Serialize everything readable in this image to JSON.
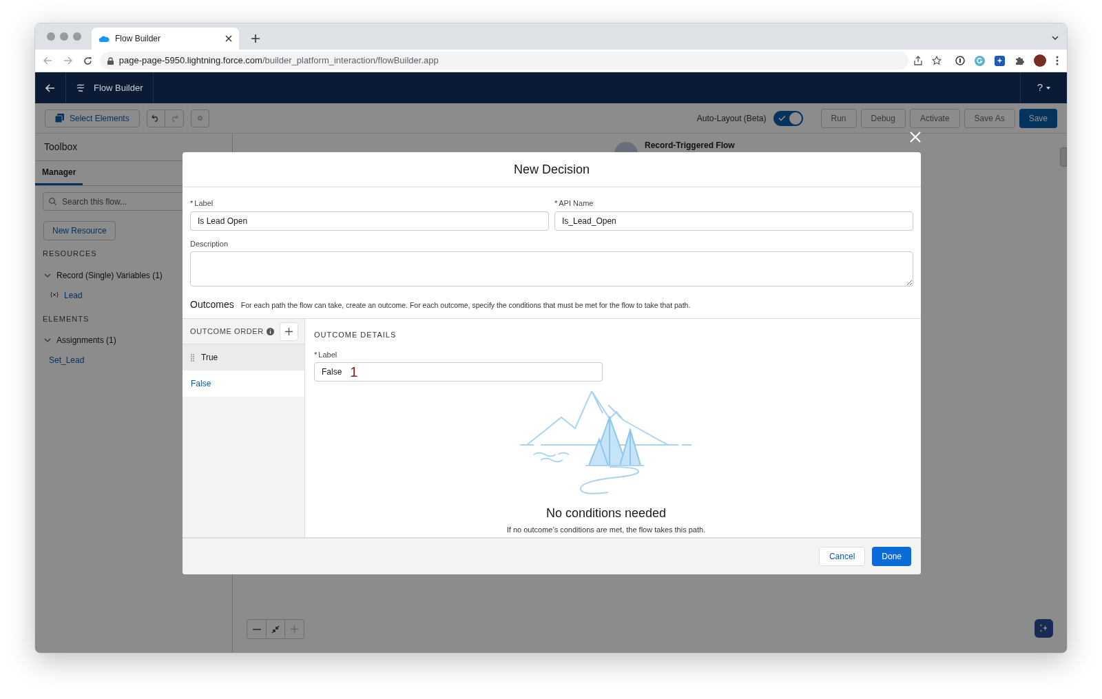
{
  "browser": {
    "tab_title": "Flow Builder",
    "url_host": "page-page-5950.lightning.force.com",
    "url_path": "/builder_platform_interaction/flowBuilder.app"
  },
  "app_header": {
    "title": "Flow Builder",
    "help": "?"
  },
  "toolbar": {
    "select_elements": "Select Elements",
    "auto_layout": {
      "label": "Auto-Layout (Beta)",
      "on": true
    },
    "buttons": [
      {
        "label": "Run",
        "kind": "neutral",
        "disabled": true
      },
      {
        "label": "Debug",
        "kind": "neutral",
        "disabled": true
      },
      {
        "label": "Activate",
        "kind": "neutral",
        "disabled": true
      },
      {
        "label": "Save As",
        "kind": "neutral",
        "disabled": true
      },
      {
        "label": "Save",
        "kind": "brand",
        "disabled": false
      }
    ]
  },
  "sidebar": {
    "title": "Toolbox",
    "tabs": [
      {
        "label": "Manager",
        "selected": true
      }
    ],
    "search": {
      "placeholder": "Search this flow..."
    },
    "new_resource": "New Resource",
    "sections": [
      {
        "heading": "RESOURCES",
        "groups": [
          {
            "label": "Record (Single) Variables (1)",
            "expanded": true,
            "children": [
              {
                "label": "Lead",
                "kind": "variable"
              }
            ]
          }
        ]
      },
      {
        "heading": "ELEMENTS",
        "groups": [
          {
            "label": "Assignments (1)",
            "expanded": true,
            "children": [
              {
                "label": "Set_Lead",
                "kind": "element"
              }
            ]
          }
        ]
      }
    ]
  },
  "canvas": {
    "start_node_title": "Record-Triggered Flow"
  },
  "modal": {
    "title": "New Decision",
    "fields": [
      {
        "required_mark": "*",
        "label": "Label",
        "value": "Is Lead Open"
      },
      {
        "required_mark": "*",
        "label": "API Name",
        "value": "Is_Lead_Open"
      }
    ],
    "description": {
      "label": "Description"
    },
    "outcomes": {
      "title": "Outcomes",
      "help": "For each path the flow can take, create an outcome. For each outcome, specify the conditions that must be met for the flow to take that path.",
      "order_heading": "OUTCOME ORDER",
      "items": [
        {
          "label": "True",
          "selected": false,
          "draggable": true
        },
        {
          "label": "False",
          "selected": true,
          "draggable": false
        }
      ],
      "details": {
        "heading": "OUTCOME DETAILS",
        "label": {
          "required_mark": "*",
          "label": "Label",
          "value": "False"
        },
        "annotation": "1",
        "empty_title": "No conditions needed",
        "empty_text": "If no outcome’s conditions are met, the flow takes this path."
      }
    },
    "footer_buttons": [
      {
        "label": "Cancel",
        "kind": "neutral"
      },
      {
        "label": "Done",
        "kind": "brand"
      }
    ]
  }
}
